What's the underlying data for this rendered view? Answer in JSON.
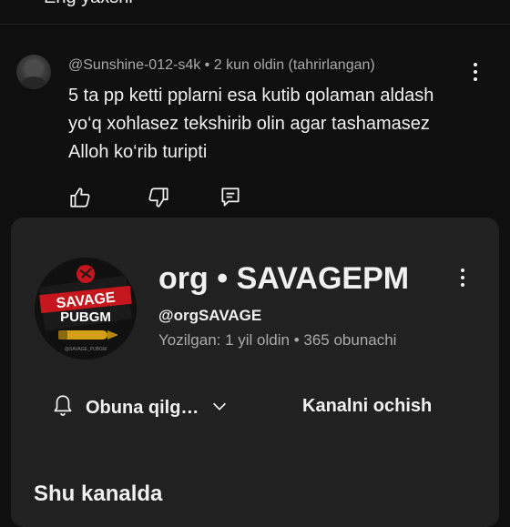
{
  "top_strip": {
    "cut_text": "Eng yaxshi"
  },
  "comment": {
    "author": "@Sunshine-012-s4k",
    "meta_rest": "• 2 kun oldin (tahrirlangan)",
    "text_lines": [
      "5 ta pp ketti pplarni esa kutib qolaman aldash",
      "yo‘q xohlasez tekshirib olin agar tashamasez",
      "Alloh ko‘rib turipti"
    ],
    "icons": {
      "like": "thumb-up-icon",
      "dislike": "thumb-down-icon",
      "reply": "reply-icon",
      "menu": "more-vert-icon"
    }
  },
  "channel_card": {
    "title": "org • SAVAGEPM",
    "handle": "@orgSAVAGE",
    "stats": "Yozilgan: 1 yil oldin • 365 obunachi",
    "logo_text": {
      "line1": "SAVAGE",
      "line2": "PUBGM",
      "small": "@SAVAGE_PUBGM"
    },
    "subscribe_label": "Obuna qilg…",
    "open_channel_label": "Kanalni ochish",
    "section_title": "Shu kanalda",
    "icons": {
      "bell": "bell-icon",
      "chevron": "chevron-down-icon",
      "menu": "more-vert-icon"
    }
  },
  "colors": {
    "background": "#0f0f0f",
    "card": "#212121",
    "text": "#f1f1f1",
    "secondary_text": "#aaaaaa",
    "logo_red": "#c4161c",
    "bullet_gold": "#d4a017"
  }
}
